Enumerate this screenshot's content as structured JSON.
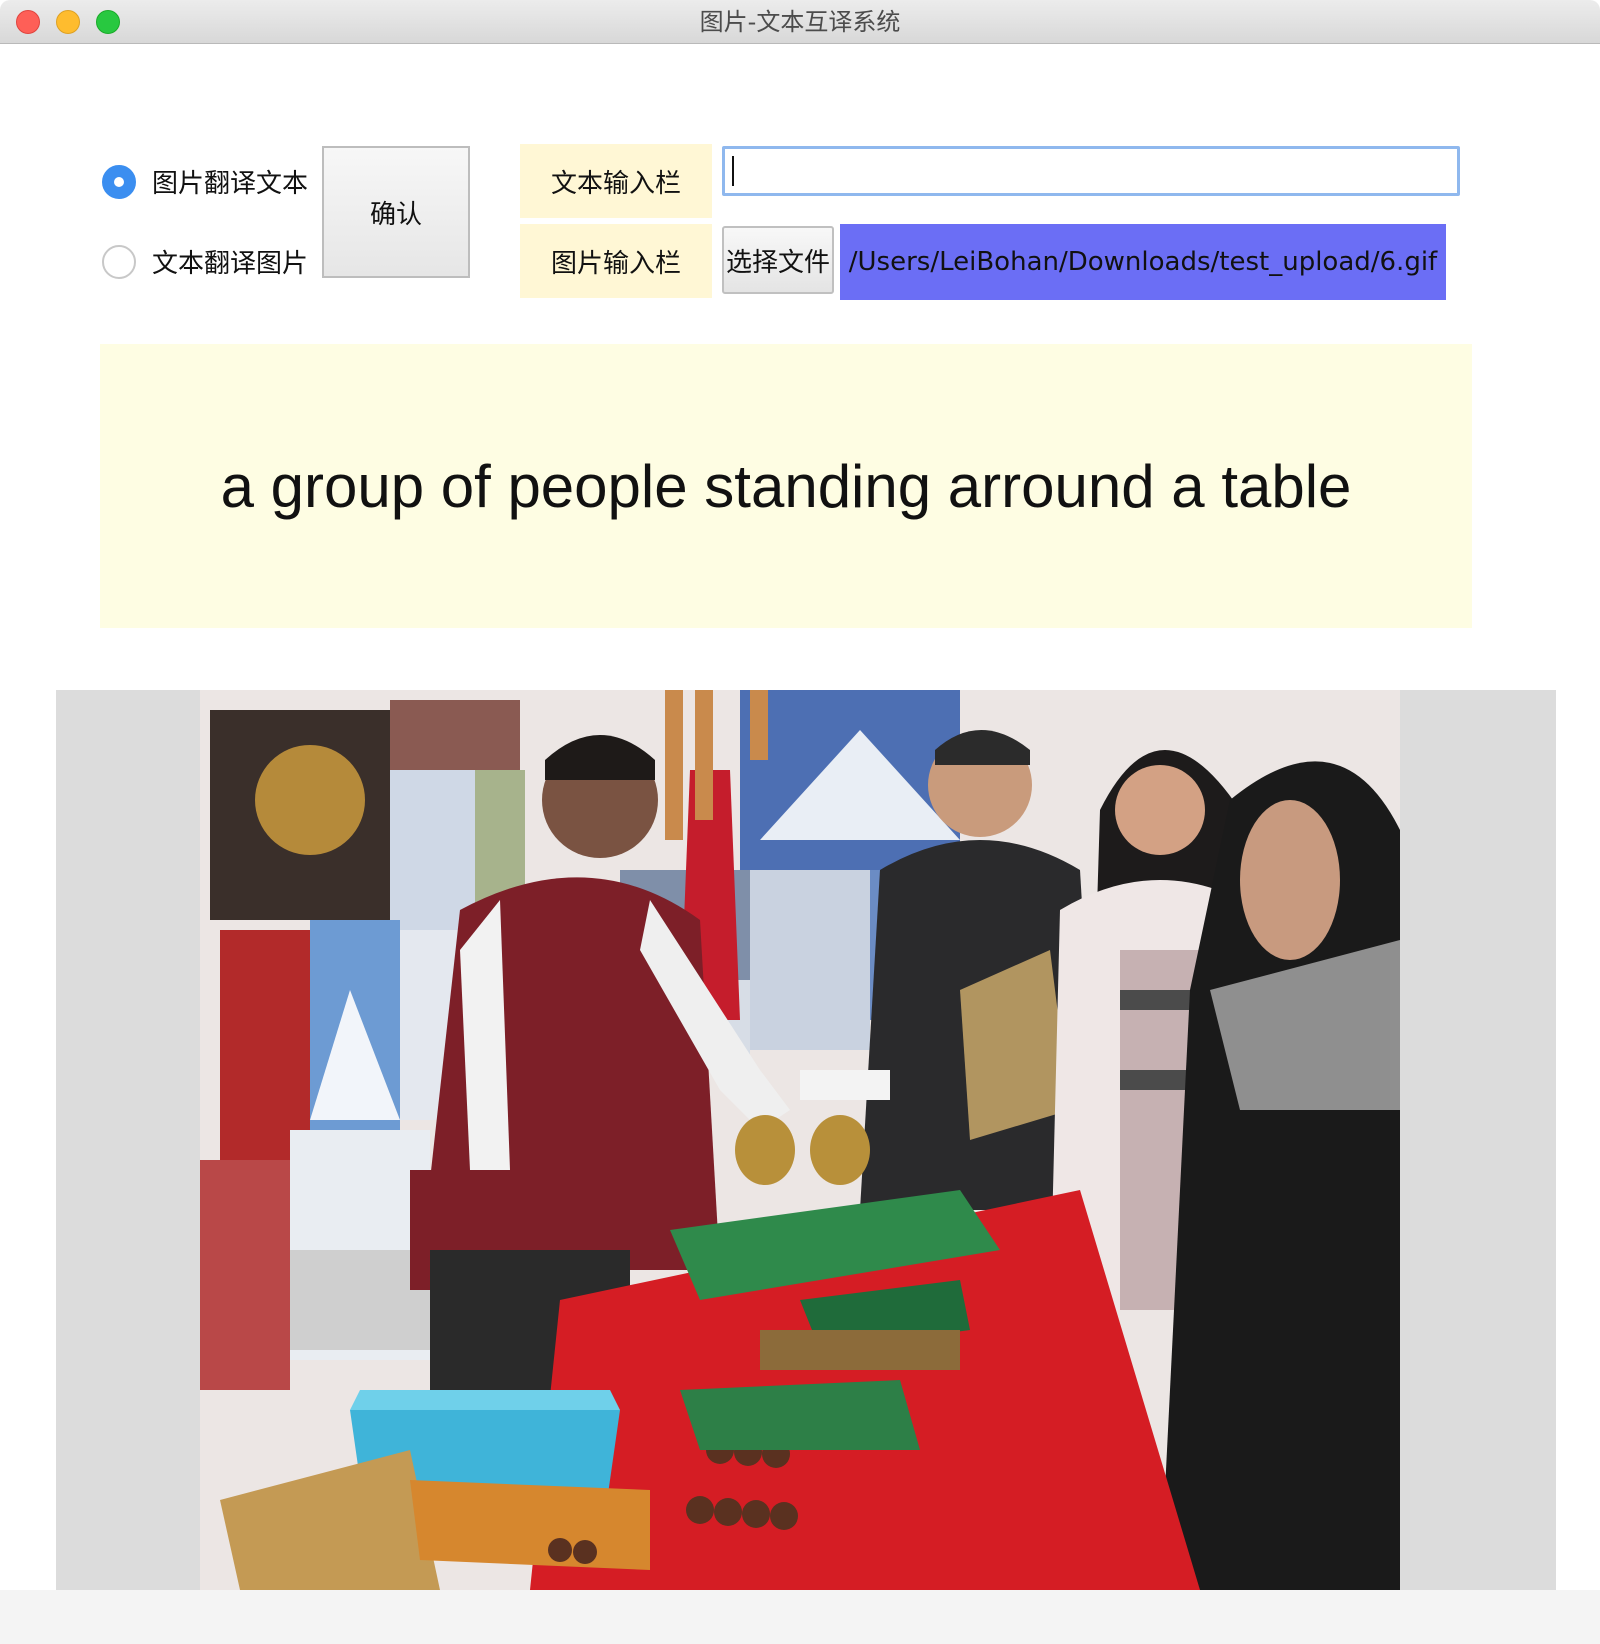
{
  "window": {
    "title": "图片-文本互译系统"
  },
  "mode": {
    "options": [
      {
        "label": "图片翻译文本",
        "checked": true
      },
      {
        "label": "文本翻译图片",
        "checked": false
      }
    ],
    "confirm_label": "确认"
  },
  "inputs": {
    "text_label": "文本输入栏",
    "text_value": "",
    "image_label": "图片输入栏",
    "choose_file_label": "选择文件",
    "file_path": "/Users/LeiBohan/Downloads/test_upload/6.gif"
  },
  "result": {
    "caption": "a group of people standing arround a table"
  },
  "colors": {
    "accent": "#3b8ef0",
    "label_bg": "#fff7d5",
    "result_bg": "#fefde3",
    "file_path_bg": "#6b6ef5"
  }
}
